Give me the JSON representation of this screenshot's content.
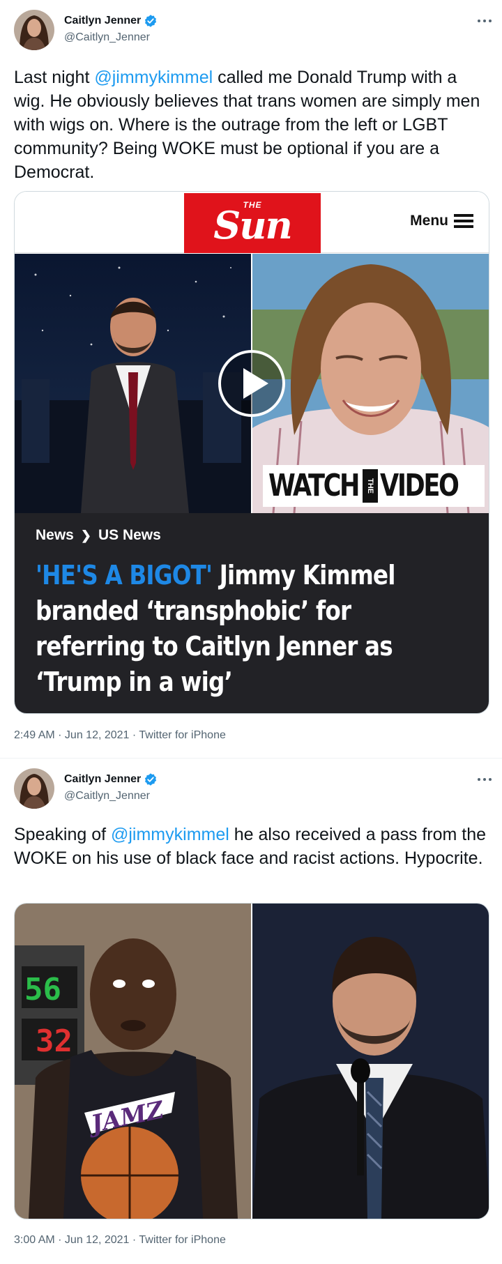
{
  "tweets": [
    {
      "author": {
        "name": "Caitlyn Jenner",
        "handle": "@Caitlyn_Jenner",
        "verified_icon": "verified-badge-icon"
      },
      "text_parts": {
        "before": "Last night ",
        "mention": "@jimmykimmel",
        "after": " called me Donald Trump with a wig. He obviously believes that trans women are simply men with wigs on. Where is the outrage from the left or LGBT community? Being WOKE must be optional if you are a Democrat."
      },
      "card": {
        "logo_small": "THE",
        "logo_big": "Sun",
        "menu_label": "Menu",
        "watch_left": "WATCH",
        "watch_mid": "THE",
        "watch_right": "VIDEO",
        "crumb_1": "News",
        "crumb_2": "US News",
        "headline_kicker": "'HE'S A BIGOT'",
        "headline_rest": " Jimmy Kimmel branded ‘transphobic’ for referring to Caitlyn Jenner as ‘Trump in a wig’"
      },
      "meta": "2:49 AM · Jun 12, 2021 · Twitter for iPhone"
    },
    {
      "author": {
        "name": "Caitlyn Jenner",
        "handle": "@Caitlyn_Jenner",
        "verified_icon": "verified-badge-icon"
      },
      "text_parts": {
        "before": "Speaking of ",
        "mention": "@jimmykimmel",
        "after": " he also received a pass from the WOKE on his use of black face and racist actions. Hypocrite."
      },
      "meta": "3:00 AM · Jun 12, 2021 · Twitter for iPhone"
    }
  ],
  "colors": {
    "link": "#1d9bf0",
    "sun_red": "#e0131b",
    "article_bg": "#222226",
    "kicker_blue": "#1e88e5"
  }
}
